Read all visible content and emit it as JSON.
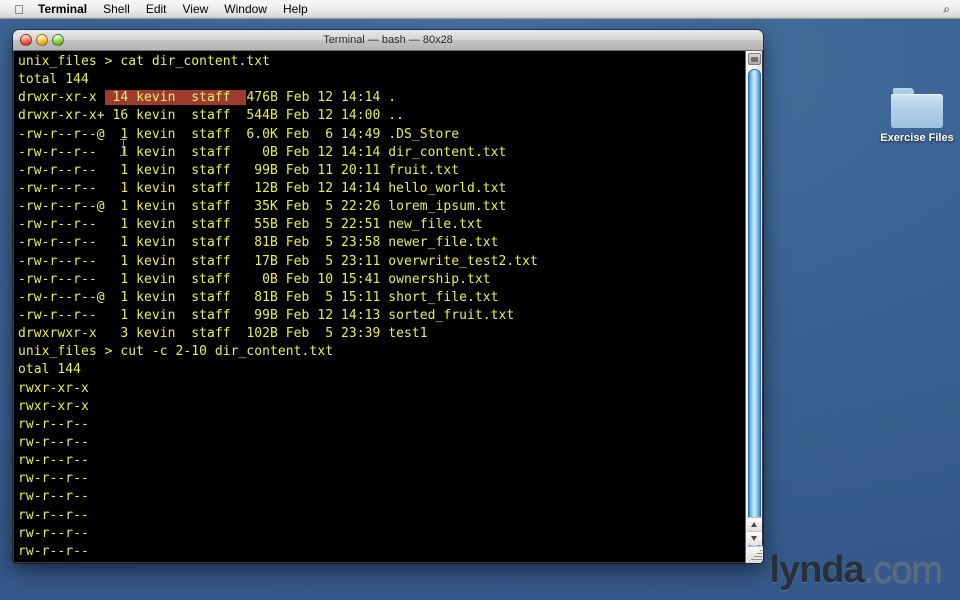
{
  "menubar": {
    "apple_icon": "apple-icon",
    "items": [
      {
        "label": "Terminal",
        "bold": true
      },
      {
        "label": "Shell",
        "bold": false
      },
      {
        "label": "Edit",
        "bold": false
      },
      {
        "label": "View",
        "bold": false
      },
      {
        "label": "Window",
        "bold": false
      },
      {
        "label": "Help",
        "bold": false
      }
    ],
    "spotlight_icon": "⌕"
  },
  "window": {
    "title": "Terminal — bash — 80x28",
    "buttons": {
      "close": "close-button",
      "minimize": "minimize-button",
      "zoom": "zoom-button"
    }
  },
  "terminal": {
    "prompt": "unix_files > ",
    "command_1": "cat dir_content.txt",
    "command_2": "cut -c 2-10 dir_content.txt",
    "listing_header": "total 144",
    "selection": " 14 kevin  staff  ",
    "rows": [
      {
        "perms": "drwxr-xr-x ",
        "pre_sel": true,
        "tail": "476B Feb 12 14:14 ."
      },
      {
        "perms": "drwxr-xr-x+",
        "links": " 16",
        "user": " kevin ",
        "group": " staff  ",
        "size": "544B",
        "date": " Feb 12 14:00 ",
        "name": ".."
      },
      {
        "perms": "-rw-r--r--@",
        "links": "  1",
        "user": " kevin ",
        "group": " staff  ",
        "size": "6.0K",
        "date": " Feb  6 14:49 ",
        "name": ".DS_Store"
      },
      {
        "perms": "-rw-r--r-- ",
        "links": "  1",
        "user": " kevin ",
        "group": " staff  ",
        "size": "  0B",
        "date": " Feb 12 14:14 ",
        "name": "dir_content.txt"
      },
      {
        "perms": "-rw-r--r-- ",
        "links": "  1",
        "user": " kevin ",
        "group": " staff  ",
        "size": " 99B",
        "date": " Feb 11 20:11 ",
        "name": "fruit.txt"
      },
      {
        "perms": "-rw-r--r-- ",
        "links": "  1",
        "user": " kevin ",
        "group": " staff  ",
        "size": " 12B",
        "date": " Feb 12 14:14 ",
        "name": "hello_world.txt"
      },
      {
        "perms": "-rw-r--r--@",
        "links": "  1",
        "user": " kevin ",
        "group": " staff  ",
        "size": " 35K",
        "date": " Feb  5 22:26 ",
        "name": "lorem_ipsum.txt"
      },
      {
        "perms": "-rw-r--r-- ",
        "links": "  1",
        "user": " kevin ",
        "group": " staff  ",
        "size": " 55B",
        "date": " Feb  5 22:51 ",
        "name": "new_file.txt"
      },
      {
        "perms": "-rw-r--r-- ",
        "links": "  1",
        "user": " kevin ",
        "group": " staff  ",
        "size": " 81B",
        "date": " Feb  5 23:58 ",
        "name": "newer_file.txt"
      },
      {
        "perms": "-rw-r--r-- ",
        "links": "  1",
        "user": " kevin ",
        "group": " staff  ",
        "size": " 17B",
        "date": " Feb  5 23:11 ",
        "name": "overwrite_test2.txt"
      },
      {
        "perms": "-rw-r--r-- ",
        "links": "  1",
        "user": " kevin ",
        "group": " staff  ",
        "size": "  0B",
        "date": " Feb 10 15:41 ",
        "name": "ownership.txt"
      },
      {
        "perms": "-rw-r--r--@",
        "links": "  1",
        "user": " kevin ",
        "group": " staff  ",
        "size": " 81B",
        "date": " Feb  5 15:11 ",
        "name": "short_file.txt"
      },
      {
        "perms": "-rw-r--r-- ",
        "links": "  1",
        "user": " kevin ",
        "group": " staff  ",
        "size": " 99B",
        "date": " Feb 12 14:13 ",
        "name": "sorted_fruit.txt"
      },
      {
        "perms": "drwxrwxr-x ",
        "links": "  3",
        "user": " kevin ",
        "group": " staff  ",
        "size": "102B",
        "date": " Feb  5 23:39 ",
        "name": "test1"
      }
    ],
    "cut_output": [
      "otal 144",
      "rwxr-xr-x",
      "rwxr-xr-x",
      "rw-r--r--",
      "rw-r--r--",
      "rw-r--r--",
      "rw-r--r--",
      "rw-r--r--",
      "rw-r--r--",
      "rw-r--r--",
      "rw-r--r--"
    ],
    "colors": {
      "foreground": "#e8ef4e",
      "background": "#000000",
      "selection": "#9c3b2e"
    }
  },
  "desktop": {
    "folder_label": "Exercise Files",
    "background_color": "#3d6695"
  },
  "watermark": {
    "brand": "lynda",
    "tld": ".com"
  }
}
